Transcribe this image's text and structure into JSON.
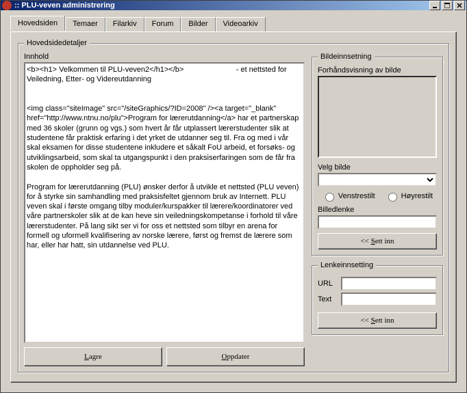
{
  "window": {
    "title": ":: PLU-veven administrering"
  },
  "tabs": {
    "items": [
      {
        "label": "Hovedsiden"
      },
      {
        "label": "Temaer"
      },
      {
        "label": "Filarkiv"
      },
      {
        "label": "Forum"
      },
      {
        "label": "Bilder"
      },
      {
        "label": "Videoarkiv"
      }
    ]
  },
  "hoved": {
    "legend": "Hovedsidedetaljer",
    "innhold_label": "Innhold",
    "innhold_text": "<b><h1> Velkommen til PLU-veven2</h1></b>                         - et nettsted for Veiledning, Etter- og Videreutdanning\n\n\n<img class=\"siteImage\" src=\"/siteGraphics/?ID=2008\" /><a target=\"_blank\" href=\"http://www.ntnu.no/plu\">Program for lærerutdanning</a> har et partnerskap med 36 skoler (grunn og vgs.) som hvert år får utplassert lærerstudenter slik at studentene får praktisk erfaring i det yrket de utdanner seg til. Fra og med i vår skal eksamen for disse studentene inkludere et såkalt FoU arbeid, et forsøks- og utviklingsarbeid, som skal ta utgangspunkt i den praksiserfaringen som de får fra skolen de oppholder seg på.\n\nProgram for lærerutdanning (PLU) ønsker derfor å utvikle et nettsted (PLU veven) for å styrke sin samhandling med praksisfeltet gjennom bruk av Internett. PLU veven skal i første omgang tilby moduler/kurspakker til lærere/koordinatorer ved våre partnerskoler slik at de kan heve sin veiledningskompetanse i forhold til våre lærerstudenter. På lang sikt ser vi for oss et nettsted som tilbyr en arena for formell og uformell kvalifisering av norske lærere, først og fremst de lærere som har, eller har hatt, sin utdannelse ved PLU.",
    "lagre_label": "Lagre",
    "oppdater_label": "Oppdater"
  },
  "bilde": {
    "legend": "Bildeinnsetning",
    "preview_label": "Forhåndsvisning av bilde",
    "velg_label": "Velg bilde",
    "venstre_label": "Venstrestilt",
    "hoyre_label": "Høyrestilt",
    "billedlenke_label": "Billedlenke",
    "sett_inn_label": "<< Sett inn"
  },
  "lenke": {
    "legend": "Lenkeinnsetting",
    "url_label": "URL",
    "text_label": "Text",
    "sett_inn_label": "<< Sett inn"
  }
}
